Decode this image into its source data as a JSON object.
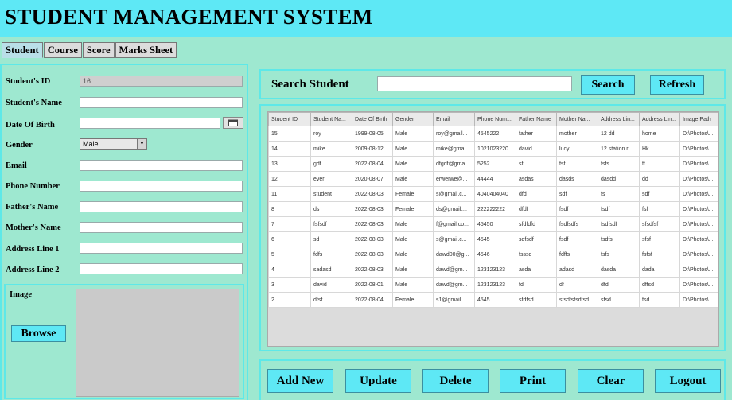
{
  "app": {
    "title": "STUDENT MANAGEMENT SYSTEM"
  },
  "tabs": [
    "Student",
    "Course",
    "Score",
    "Marks Sheet"
  ],
  "form": {
    "student_id_label": "Student's ID",
    "student_id_value": "16",
    "student_name_label": "Student's Name",
    "dob_label": "Date Of Birth",
    "gender_label": "Gender",
    "gender_value": "Male",
    "email_label": "Email",
    "phone_label": "Phone Number",
    "father_label": "Father's Name",
    "mother_label": "Mother's Name",
    "address1_label": "Address Line 1",
    "address2_label": "Address Line 2",
    "image_label": "Image",
    "browse_label": "Browse"
  },
  "search": {
    "label": "Search Student",
    "search_button": "Search",
    "refresh_button": "Refresh"
  },
  "table": {
    "columns": [
      "Student ID",
      "Student Na...",
      "Date Of Birth",
      "Gender",
      "Email",
      "Phone Num...",
      "Father Name",
      "Mother Na...",
      "Address Lin...",
      "Address Lin...",
      "Image Path"
    ],
    "rows": [
      [
        "15",
        "roy",
        "1999-08-05",
        "Male",
        "roy@gmail...",
        "4545222",
        "father",
        "mother",
        "12 dd",
        "home",
        "D:\\Photos\\..."
      ],
      [
        "14",
        "mike",
        "2009-08-12",
        "Male",
        "mike@gma...",
        "1021023220",
        "david",
        "lucy",
        "12 station r...",
        "Hk",
        "D:\\Photos\\..."
      ],
      [
        "13",
        "gdf",
        "2022-08-04",
        "Male",
        "dfgdf@gma...",
        "5252",
        "sfl",
        "fsf",
        "fsfs",
        "ff",
        "D:\\Photos\\..."
      ],
      [
        "12",
        "ever",
        "2020-08-07",
        "Male",
        "erwerwe@...",
        "44444",
        "asdas",
        "dasds",
        "dasdd",
        "dd",
        "D:\\Photos\\..."
      ],
      [
        "11",
        "student",
        "2022-08-03",
        "Female",
        "s@gmail.c...",
        "4040404040",
        "dfd",
        "sdf",
        "fs",
        "sdf",
        "D:\\Photos\\..."
      ],
      [
        "8",
        "ds",
        "2022-08-03",
        "Female",
        "ds@gmail....",
        "222222222",
        "dfdf",
        "fsdf",
        "fsdf",
        "fsf",
        "D:\\Photos\\..."
      ],
      [
        "7",
        "fsfsdf",
        "2022-08-03",
        "Male",
        "f@gmail.co...",
        "45450",
        "sfdfdfd",
        "fsdfsdfs",
        "fsdfsdf",
        "sfsdfsf",
        "D:\\Photos\\..."
      ],
      [
        "6",
        "sd",
        "2022-08-03",
        "Male",
        "s@gmail.c...",
        "4545",
        "sdfsdf",
        "fsdf",
        "fsdfs",
        "sfsf",
        "D:\\Photos\\..."
      ],
      [
        "5",
        "fdfs",
        "2022-08-03",
        "Male",
        "dawd00@g...",
        "4546",
        "fsssd",
        "fdffs",
        "fsfs",
        "fsfsf",
        "D:\\Photos\\..."
      ],
      [
        "4",
        "sadasd",
        "2022-08-03",
        "Male",
        "dawd@gm...",
        "123123123",
        "asda",
        "adasd",
        "dasda",
        "dada",
        "D:\\Photos\\..."
      ],
      [
        "3",
        "david",
        "2022-08-01",
        "Male",
        "dawd@gm...",
        "123123123",
        "fd",
        "df",
        "dfd",
        "dffsd",
        "D:\\Photos\\..."
      ],
      [
        "2",
        "dfsf",
        "2022-08-04",
        "Female",
        "s1@gmail....",
        "4545",
        "sfdfsd",
        "sfsdfsfsdfsd",
        "sfsd",
        "fsd",
        "D:\\Photos\\..."
      ]
    ]
  },
  "actions": [
    "Add New",
    "Update",
    "Delete",
    "Print",
    "Clear",
    "Logout"
  ],
  "colors": {
    "header_bg": "#5ee8f5",
    "body_bg": "#9ee8d0",
    "button_bg": "#5ee8f5",
    "panel_border": "#5ee8e8"
  }
}
